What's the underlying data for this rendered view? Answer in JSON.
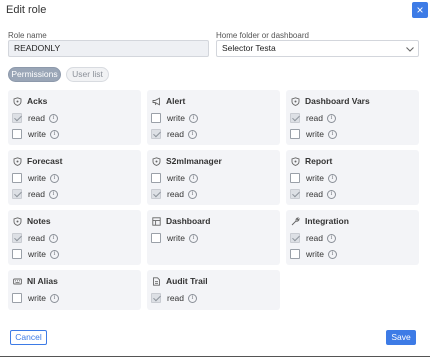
{
  "dialog": {
    "title": "Edit role",
    "close_label": "×"
  },
  "form": {
    "role_name_label": "Role name",
    "role_name_value": "READONLY",
    "home_label": "Home folder or dashboard",
    "home_value": "Selector Testa"
  },
  "tabs": [
    {
      "label": "Permissions",
      "active": true
    },
    {
      "label": "User list",
      "active": false
    }
  ],
  "cards": [
    {
      "title": "Acks",
      "icon": "shield-icon",
      "rows": [
        {
          "label": "read",
          "checked": true
        },
        {
          "label": "write",
          "checked": false
        }
      ]
    },
    {
      "title": "Alert",
      "icon": "megaphone-icon",
      "rows": [
        {
          "label": "write",
          "checked": false
        },
        {
          "label": "read",
          "checked": true
        }
      ]
    },
    {
      "title": "Dashboard Vars",
      "icon": "shield-icon",
      "rows": [
        {
          "label": "read",
          "checked": true
        },
        {
          "label": "write",
          "checked": false
        }
      ]
    },
    {
      "title": "Forecast",
      "icon": "shield-icon",
      "rows": [
        {
          "label": "write",
          "checked": false
        },
        {
          "label": "read",
          "checked": true
        }
      ]
    },
    {
      "title": "S2mlmanager",
      "icon": "shield-icon",
      "rows": [
        {
          "label": "write",
          "checked": false
        },
        {
          "label": "read",
          "checked": true
        }
      ]
    },
    {
      "title": "Report",
      "icon": "shield-icon",
      "rows": [
        {
          "label": "write",
          "checked": false
        },
        {
          "label": "read",
          "checked": true
        }
      ]
    },
    {
      "title": "Notes",
      "icon": "shield-icon",
      "rows": [
        {
          "label": "read",
          "checked": true
        },
        {
          "label": "write",
          "checked": false
        }
      ]
    },
    {
      "title": "Dashboard",
      "icon": "dashboard-icon",
      "rows": [
        {
          "label": "write",
          "checked": false
        }
      ]
    },
    {
      "title": "Integration",
      "icon": "wrench-icon",
      "rows": [
        {
          "label": "read",
          "checked": true
        },
        {
          "label": "write",
          "checked": false
        }
      ]
    },
    {
      "title": "Nl Alias",
      "icon": "keyboard-icon",
      "rows": [
        {
          "label": "write",
          "checked": false
        }
      ]
    },
    {
      "title": "Audit Trail",
      "icon": "document-icon",
      "rows": [
        {
          "label": "read",
          "checked": true
        }
      ]
    }
  ],
  "info_glyph": "i",
  "footer": {
    "cancel_label": "Cancel",
    "save_label": "Save"
  },
  "colors": {
    "accent": "#3d7be6",
    "card_bg": "#f3f4f7",
    "tab_active_bg": "#9aa6b7"
  }
}
